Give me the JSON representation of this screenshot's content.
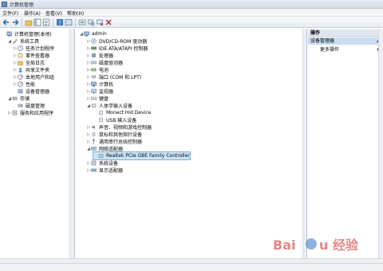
{
  "window": {
    "title": "计算机管理"
  },
  "menu": [
    "文件(F)",
    "操作(A)",
    "查看(V)",
    "帮助(H)"
  ],
  "left_tree": [
    {
      "label": "计算机管理(本地)",
      "indent": 0,
      "expander": "",
      "icon": "computer-management-icon"
    },
    {
      "label": "系统工具",
      "indent": 1,
      "expander": "◢",
      "icon": "tools-icon"
    },
    {
      "label": "任务计划程序",
      "indent": 2,
      "expander": "▷",
      "icon": "task-scheduler-icon"
    },
    {
      "label": "事件查看器",
      "indent": 2,
      "expander": "▷",
      "icon": "event-viewer-icon"
    },
    {
      "label": "全局日志",
      "indent": 2,
      "expander": "▷",
      "icon": "shared-folders-icon"
    },
    {
      "label": "共享文件夹",
      "indent": 2,
      "expander": "▷",
      "icon": "users-icon"
    },
    {
      "label": "本地用户和组",
      "indent": 2,
      "expander": "▷",
      "icon": "performance-icon"
    },
    {
      "label": "性能",
      "indent": 2,
      "expander": "▷",
      "icon": "performance-icon"
    },
    {
      "label": "设备管理器",
      "indent": 2,
      "expander": "",
      "icon": "device-manager-icon"
    },
    {
      "label": "存储",
      "indent": 1,
      "expander": "◢",
      "icon": "storage-icon"
    },
    {
      "label": "磁盘管理",
      "indent": 2,
      "expander": "",
      "icon": "disk-icon"
    },
    {
      "label": "服务和应用程序",
      "indent": 1,
      "expander": "▷",
      "icon": "services-icon"
    }
  ],
  "device_tree": [
    {
      "label": "admin",
      "indent": 0,
      "expander": "◢",
      "icon": "computer-icon",
      "selected": false
    },
    {
      "label": "DVD/CD-ROM 驱动器",
      "indent": 1,
      "expander": "▷",
      "icon": "dvd-icon",
      "selected": false
    },
    {
      "label": "IDE ATA/ATAPI 控制器",
      "indent": 1,
      "expander": "▷",
      "icon": "ide-controller-icon",
      "selected": false
    },
    {
      "label": "处理器",
      "indent": 1,
      "expander": "▷",
      "icon": "processor-icon",
      "selected": false
    },
    {
      "label": "磁盘驱动器",
      "indent": 1,
      "expander": "▷",
      "icon": "disk-drive-icon",
      "selected": false
    },
    {
      "label": "电池",
      "indent": 1,
      "expander": "▷",
      "icon": "battery-icon",
      "selected": false
    },
    {
      "label": "端口 (COM 和 LPT)",
      "indent": 1,
      "expander": "▷",
      "icon": "port-icon",
      "selected": false
    },
    {
      "label": "计算机",
      "indent": 1,
      "expander": "▷",
      "icon": "computer-icon",
      "selected": false
    },
    {
      "label": "监视器",
      "indent": 1,
      "expander": "▷",
      "icon": "monitor-icon",
      "selected": false
    },
    {
      "label": "键盘",
      "indent": 1,
      "expander": "▷",
      "icon": "keyboard-icon",
      "selected": false
    },
    {
      "label": "人体学输入设备",
      "indent": 1,
      "expander": "◢",
      "icon": "hid-icon",
      "selected": false
    },
    {
      "label": "Monect Hid Device",
      "indent": 2,
      "expander": "",
      "icon": "hid-device-icon",
      "selected": false
    },
    {
      "label": "USB 输入设备",
      "indent": 2,
      "expander": "",
      "icon": "hid-device-icon",
      "selected": false
    },
    {
      "label": "声音、视频和游戏控制器",
      "indent": 1,
      "expander": "▷",
      "icon": "sound-icon",
      "selected": false
    },
    {
      "label": "鼠标和其他指针设备",
      "indent": 1,
      "expander": "▷",
      "icon": "mouse-icon",
      "selected": false
    },
    {
      "label": "通用串行总线控制器",
      "indent": 1,
      "expander": "▷",
      "icon": "usb-icon",
      "selected": false
    },
    {
      "label": "网络适配器",
      "indent": 1,
      "expander": "◢",
      "icon": "network-icon",
      "selected": false
    },
    {
      "label": "Realtek PCIe GBE Family Controller",
      "indent": 2,
      "expander": "",
      "icon": "network-adapter-icon",
      "selected": true
    },
    {
      "label": "系统设备",
      "indent": 1,
      "expander": "▷",
      "icon": "system-device-icon",
      "selected": false
    },
    {
      "label": "显示适配器",
      "indent": 1,
      "expander": "▷",
      "icon": "display-adapter-icon",
      "selected": false
    }
  ],
  "actions": {
    "header": "操作",
    "section": "设备管理器",
    "more": "更多操作"
  },
  "watermark_text": "Baidu 经验",
  "colors": {
    "selection": "#cce4f7",
    "accent": "#3e6190",
    "watermark": "#d22020"
  }
}
